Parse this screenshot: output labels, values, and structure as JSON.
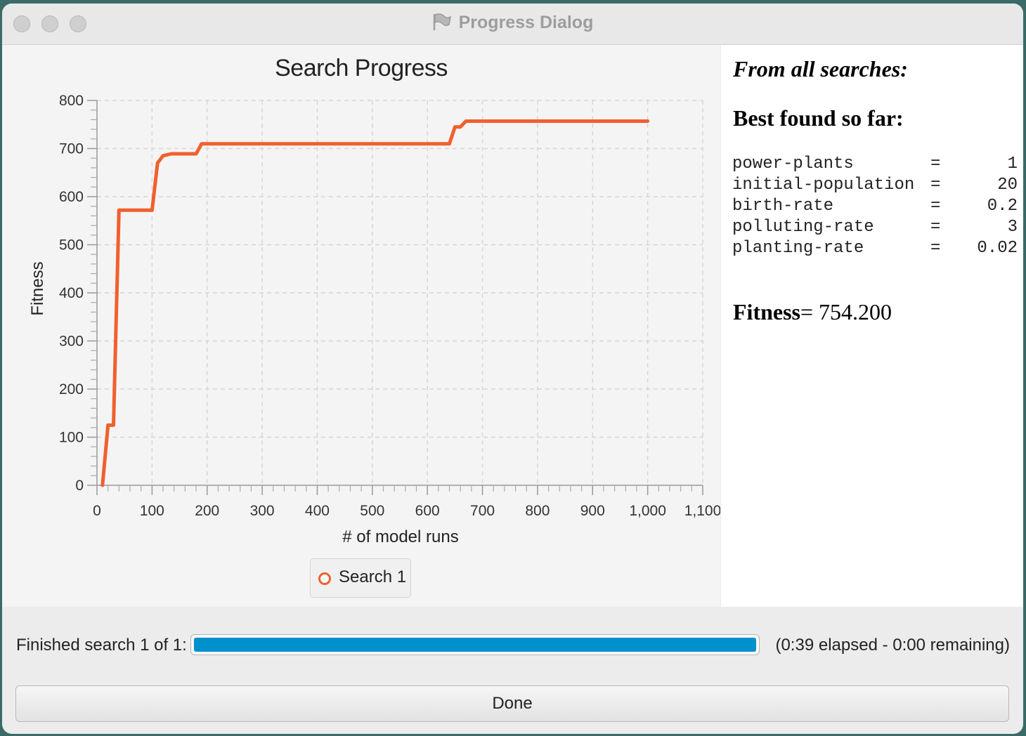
{
  "window": {
    "title": "Progress Dialog",
    "icon": "app-flag-icon"
  },
  "chart": {
    "title": "Search Progress",
    "xlabel": "# of model runs",
    "ylabel": "Fitness",
    "legend_label": "Search 1"
  },
  "chart_data": {
    "type": "line",
    "title": "Search Progress",
    "xlabel": "# of model runs",
    "ylabel": "Fitness",
    "xlim": [
      0,
      1100
    ],
    "ylim": [
      0,
      800
    ],
    "x_ticks": [
      "0",
      "100",
      "200",
      "300",
      "400",
      "500",
      "600",
      "700",
      "800",
      "900",
      "1,000",
      "1,100"
    ],
    "y_ticks": [
      "0",
      "100",
      "200",
      "300",
      "400",
      "500",
      "600",
      "700",
      "800"
    ],
    "grid": true,
    "legend": "bottom-center",
    "series": [
      {
        "name": "Search 1",
        "color": "#f0602e",
        "x": [
          10,
          20,
          30,
          40,
          100,
          110,
          120,
          135,
          180,
          190,
          640,
          650,
          660,
          670,
          1000
        ],
        "y": [
          0,
          125,
          125,
          572,
          572,
          670,
          685,
          689,
          689,
          710,
          710,
          745,
          745,
          757,
          757
        ]
      }
    ]
  },
  "info": {
    "heading": "From all searches:",
    "subheading": "Best found so far:",
    "params": [
      {
        "name": "power-plants",
        "eq": "=",
        "value": "1"
      },
      {
        "name": "initial-population",
        "eq": "=",
        "value": "20"
      },
      {
        "name": "birth-rate",
        "eq": "=",
        "value": "0.2"
      },
      {
        "name": "polluting-rate",
        "eq": "=",
        "value": "3"
      },
      {
        "name": "planting-rate",
        "eq": "=",
        "value": "0.02"
      }
    ],
    "fitness_label": "Fitness",
    "fitness_value": "= 754.200"
  },
  "status": {
    "label": "Finished search 1 of 1:",
    "progress": 1.0,
    "progress_color": "#0090cc",
    "elapsed": "(0:39 elapsed - 0:00 remaining)"
  },
  "done_label": "Done"
}
